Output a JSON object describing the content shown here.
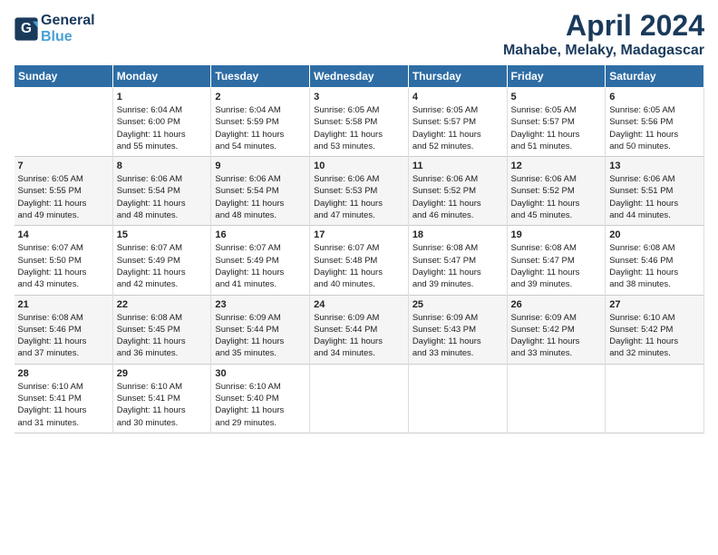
{
  "header": {
    "logo_line1": "General",
    "logo_line2": "Blue",
    "month": "April 2024",
    "location": "Mahabe, Melaky, Madagascar"
  },
  "weekdays": [
    "Sunday",
    "Monday",
    "Tuesday",
    "Wednesday",
    "Thursday",
    "Friday",
    "Saturday"
  ],
  "weeks": [
    [
      {
        "day": "",
        "info": ""
      },
      {
        "day": "1",
        "info": "Sunrise: 6:04 AM\nSunset: 6:00 PM\nDaylight: 11 hours\nand 55 minutes."
      },
      {
        "day": "2",
        "info": "Sunrise: 6:04 AM\nSunset: 5:59 PM\nDaylight: 11 hours\nand 54 minutes."
      },
      {
        "day": "3",
        "info": "Sunrise: 6:05 AM\nSunset: 5:58 PM\nDaylight: 11 hours\nand 53 minutes."
      },
      {
        "day": "4",
        "info": "Sunrise: 6:05 AM\nSunset: 5:57 PM\nDaylight: 11 hours\nand 52 minutes."
      },
      {
        "day": "5",
        "info": "Sunrise: 6:05 AM\nSunset: 5:57 PM\nDaylight: 11 hours\nand 51 minutes."
      },
      {
        "day": "6",
        "info": "Sunrise: 6:05 AM\nSunset: 5:56 PM\nDaylight: 11 hours\nand 50 minutes."
      }
    ],
    [
      {
        "day": "7",
        "info": "Sunrise: 6:05 AM\nSunset: 5:55 PM\nDaylight: 11 hours\nand 49 minutes."
      },
      {
        "day": "8",
        "info": "Sunrise: 6:06 AM\nSunset: 5:54 PM\nDaylight: 11 hours\nand 48 minutes."
      },
      {
        "day": "9",
        "info": "Sunrise: 6:06 AM\nSunset: 5:54 PM\nDaylight: 11 hours\nand 48 minutes."
      },
      {
        "day": "10",
        "info": "Sunrise: 6:06 AM\nSunset: 5:53 PM\nDaylight: 11 hours\nand 47 minutes."
      },
      {
        "day": "11",
        "info": "Sunrise: 6:06 AM\nSunset: 5:52 PM\nDaylight: 11 hours\nand 46 minutes."
      },
      {
        "day": "12",
        "info": "Sunrise: 6:06 AM\nSunset: 5:52 PM\nDaylight: 11 hours\nand 45 minutes."
      },
      {
        "day": "13",
        "info": "Sunrise: 6:06 AM\nSunset: 5:51 PM\nDaylight: 11 hours\nand 44 minutes."
      }
    ],
    [
      {
        "day": "14",
        "info": "Sunrise: 6:07 AM\nSunset: 5:50 PM\nDaylight: 11 hours\nand 43 minutes."
      },
      {
        "day": "15",
        "info": "Sunrise: 6:07 AM\nSunset: 5:49 PM\nDaylight: 11 hours\nand 42 minutes."
      },
      {
        "day": "16",
        "info": "Sunrise: 6:07 AM\nSunset: 5:49 PM\nDaylight: 11 hours\nand 41 minutes."
      },
      {
        "day": "17",
        "info": "Sunrise: 6:07 AM\nSunset: 5:48 PM\nDaylight: 11 hours\nand 40 minutes."
      },
      {
        "day": "18",
        "info": "Sunrise: 6:08 AM\nSunset: 5:47 PM\nDaylight: 11 hours\nand 39 minutes."
      },
      {
        "day": "19",
        "info": "Sunrise: 6:08 AM\nSunset: 5:47 PM\nDaylight: 11 hours\nand 39 minutes."
      },
      {
        "day": "20",
        "info": "Sunrise: 6:08 AM\nSunset: 5:46 PM\nDaylight: 11 hours\nand 38 minutes."
      }
    ],
    [
      {
        "day": "21",
        "info": "Sunrise: 6:08 AM\nSunset: 5:46 PM\nDaylight: 11 hours\nand 37 minutes."
      },
      {
        "day": "22",
        "info": "Sunrise: 6:08 AM\nSunset: 5:45 PM\nDaylight: 11 hours\nand 36 minutes."
      },
      {
        "day": "23",
        "info": "Sunrise: 6:09 AM\nSunset: 5:44 PM\nDaylight: 11 hours\nand 35 minutes."
      },
      {
        "day": "24",
        "info": "Sunrise: 6:09 AM\nSunset: 5:44 PM\nDaylight: 11 hours\nand 34 minutes."
      },
      {
        "day": "25",
        "info": "Sunrise: 6:09 AM\nSunset: 5:43 PM\nDaylight: 11 hours\nand 33 minutes."
      },
      {
        "day": "26",
        "info": "Sunrise: 6:09 AM\nSunset: 5:42 PM\nDaylight: 11 hours\nand 33 minutes."
      },
      {
        "day": "27",
        "info": "Sunrise: 6:10 AM\nSunset: 5:42 PM\nDaylight: 11 hours\nand 32 minutes."
      }
    ],
    [
      {
        "day": "28",
        "info": "Sunrise: 6:10 AM\nSunset: 5:41 PM\nDaylight: 11 hours\nand 31 minutes."
      },
      {
        "day": "29",
        "info": "Sunrise: 6:10 AM\nSunset: 5:41 PM\nDaylight: 11 hours\nand 30 minutes."
      },
      {
        "day": "30",
        "info": "Sunrise: 6:10 AM\nSunset: 5:40 PM\nDaylight: 11 hours\nand 29 minutes."
      },
      {
        "day": "",
        "info": ""
      },
      {
        "day": "",
        "info": ""
      },
      {
        "day": "",
        "info": ""
      },
      {
        "day": "",
        "info": ""
      }
    ]
  ]
}
